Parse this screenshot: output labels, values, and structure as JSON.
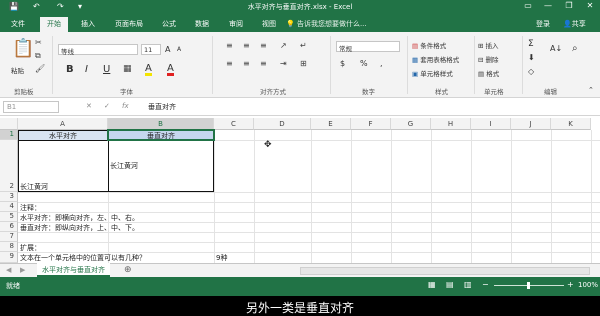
{
  "window": {
    "title": "水平对齐与垂直对齐.xlsx - Excel",
    "save_glyph": "💾",
    "undo_glyph": "↶",
    "redo_glyph": "↷",
    "more_glyph": "▾",
    "min_glyph": "—",
    "max_glyph": "❐",
    "close_glyph": "✕",
    "ribbon_toggle_glyph": "▭"
  },
  "tabs": [
    "文件",
    "开始",
    "插入",
    "页面布局",
    "公式",
    "数据",
    "审阅",
    "视图"
  ],
  "active_tab": "开始",
  "tell_me": "告诉我您想要做什么...",
  "account": {
    "login": "登录",
    "share": "共享"
  },
  "ribbon": {
    "paste_label": "粘贴",
    "clipboard_label": "剪贴板",
    "font_name": "等线",
    "font_size": "11",
    "bold": "B",
    "italic": "I",
    "underline": "U",
    "grow_font": "A",
    "shrink_font": "A",
    "font_color_glyph": "A",
    "fill_glyph": "A",
    "font_group": "字体",
    "align_group": "对齐方式",
    "number_format": "常规",
    "number_group": "数字",
    "percent": "%",
    "comma": ",",
    "currency": "$",
    "cond_format": "条件格式",
    "table_format": "套用表格格式",
    "cell_style": "单元格样式",
    "styles_group": "样式",
    "insert": "插入",
    "delete": "删除",
    "format": "格式",
    "cells_group": "单元格",
    "sum_glyph": "Σ",
    "sort_glyph": "A↓",
    "find_glyph": "⌕",
    "fill_btn_glyph": "⬇",
    "clear_glyph": "◇",
    "editing_group": "编辑"
  },
  "formula_bar": {
    "name_box": "B1",
    "cancel": "✕",
    "enter": "✓",
    "fx": "fx",
    "content": "垂直对齐"
  },
  "columns": [
    "A",
    "B",
    "C",
    "D",
    "E",
    "F",
    "G",
    "H",
    "I",
    "J",
    "K"
  ],
  "rows": [
    "1",
    "2",
    "3",
    "4",
    "5",
    "6",
    "7",
    "8",
    "9"
  ],
  "cells": {
    "A1": "水平对齐",
    "B1": "垂直对齐",
    "A2": "长江黄河",
    "B2": "长江黄河",
    "A4": "注释：",
    "A5": "水平对齐：即横向对齐，左、中、右。",
    "A6": "垂直对齐：即纵向对齐，上、中、下。",
    "A8": "扩展：",
    "A9": "文本在一个单元格中的位置可以有几种？",
    "C9": "9种"
  },
  "sheet_tab": "水平对齐与垂直对齐",
  "add_sheet": "⊕",
  "status": {
    "ready": "就绪",
    "zoom": "100%",
    "zoom_minus": "−",
    "zoom_plus": "+"
  },
  "subtitle": "另外一类是垂直对齐"
}
